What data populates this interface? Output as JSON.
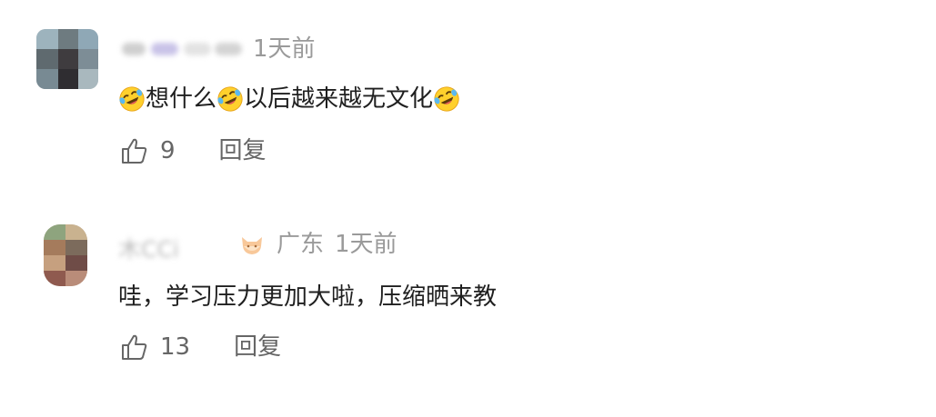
{
  "comments": [
    {
      "user": {
        "name": "",
        "location": ""
      },
      "time": "1天前",
      "content": {
        "parts": [
          {
            "type": "emoji",
            "name": "rofl-emoji"
          },
          {
            "type": "text",
            "text": "想什么"
          },
          {
            "type": "emoji",
            "name": "rofl-emoji"
          },
          {
            "type": "text",
            "text": "以后越来越无文化"
          },
          {
            "type": "emoji",
            "name": "rofl-emoji"
          }
        ]
      },
      "likes": "9",
      "reply_label": "回复"
    },
    {
      "user": {
        "name": "木CCi",
        "location": "广东",
        "badge_icon": "fox-badge-icon"
      },
      "time": "1天前",
      "content": {
        "text": "哇，学习压力更加大啦，压缩晒来教"
      },
      "likes": "13",
      "reply_label": "回复"
    }
  ],
  "icons": {
    "like": "thumbs-up-icon",
    "badge": "fox-badge-icon",
    "emoji": "rofl-emoji"
  },
  "colors": {
    "text": "#1f1f1f",
    "meta": "#9a9a9a",
    "action": "#666666",
    "badge": "#f5b27a"
  }
}
